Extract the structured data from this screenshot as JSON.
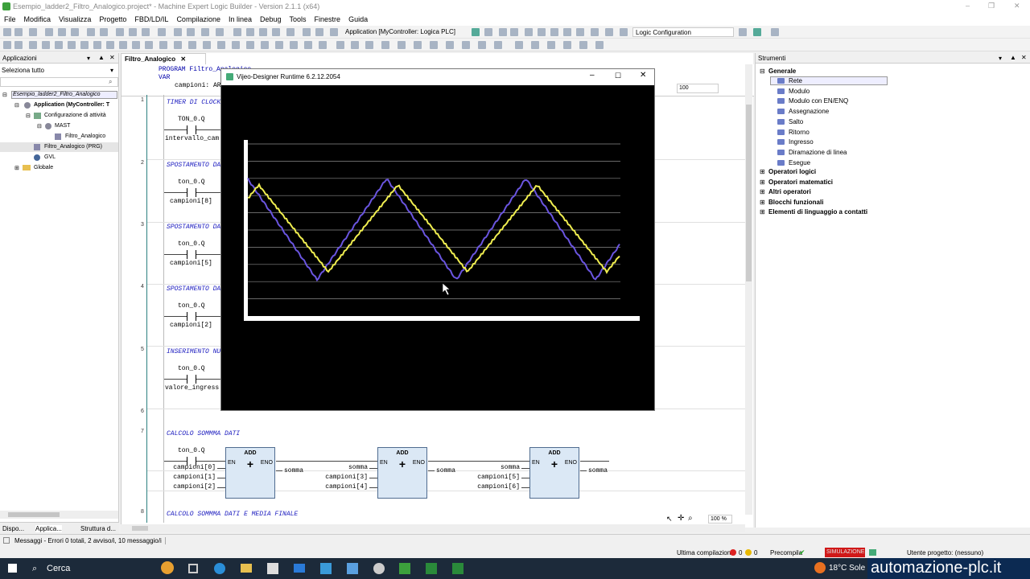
{
  "window": {
    "title": "Esempio_ladder2_Filtro_Analogico.project* - Machine Expert Logic Builder - Version 2.1.1 (x64)"
  },
  "menu": [
    "File",
    "Modifica",
    "Visualizza",
    "Progetto",
    "FBD/LD/IL",
    "Compilazione",
    "In linea",
    "Debug",
    "Tools",
    "Finestre",
    "Guida"
  ],
  "toolbar": {
    "application": "Application [MyController: Logica PLC]",
    "logic": "Logic Configuration"
  },
  "left": {
    "title": "Applicazioni",
    "select": "Seleziona tutto",
    "tree": [
      "Esempio_ladder2_Filtro_Analogico",
      "Application (MyController: T",
      "Configurazione di attività",
      "MAST",
      "Filtro_Analogico",
      "Filtro_Analogico (PRG)",
      "GVL",
      "Globale"
    ],
    "tabs": [
      "Dispo...",
      "Applica...",
      "Struttura d..."
    ]
  },
  "editor": {
    "tab": "Filtro_Analogico",
    "decl": [
      "PROGRAM Filtro_Analogico",
      "VAR",
      "campioni: ARRAY"
    ],
    "zoom_top": "100",
    "rungs": [
      {
        "num": "1",
        "title": "TIMER DI CLOCK",
        "contact": "TON_0.Q",
        "var": "intervallo_cam"
      },
      {
        "num": "2",
        "title": "SPOSTAMENTO DA",
        "contact": "ton_0.Q",
        "var": "campioni[8]"
      },
      {
        "num": "3",
        "title": "SPOSTAMENTO DA",
        "contact": "ton_0.Q",
        "var": "campioni[5]"
      },
      {
        "num": "4",
        "title": "SPOSTAMENTO DA",
        "contact": "ton_0.Q",
        "var": "campioni[2]"
      },
      {
        "num": "5",
        "title": "INSERIMENTO NU",
        "contact": "ton_0.Q",
        "var": "valore_ingress"
      },
      {
        "num": "6",
        "title": "",
        "contact": "",
        "var": ""
      },
      {
        "num": "7",
        "title": "CALCOLO SOMMMA DATI",
        "contact": "ton_0.Q",
        "var": ""
      },
      {
        "num": "8",
        "title": "CALCOLO SOMMMA DATI E MEDIA FINALE",
        "contact": "",
        "var": ""
      }
    ],
    "blocks": [
      {
        "name": "ADD",
        "en": "EN",
        "eno": "ENO",
        "inputs": [
          "campioni[0]",
          "campioni[1]",
          "campioni[2]"
        ],
        "output": "somma"
      },
      {
        "name": "ADD",
        "en": "EN",
        "eno": "ENO",
        "inputs": [
          "somma",
          "campioni[3]",
          "campioni[4]"
        ],
        "output": "somma"
      },
      {
        "name": "ADD",
        "en": "EN",
        "eno": "ENO",
        "inputs": [
          "somma",
          "campioni[5]",
          "campioni[6]"
        ],
        "output": "somma"
      }
    ],
    "zoom_bottom": "100 %"
  },
  "right": {
    "title": "Strumenti",
    "general": "Generale",
    "items": [
      "Rete",
      "Modulo",
      "Modulo con EN/ENQ",
      "Assegnazione",
      "Salto",
      "Ritorno",
      "Ingresso",
      "Diramazione di linea",
      "Esegue"
    ],
    "groups": [
      "Operatori logici",
      "Operatori matematici",
      "Altri operatori",
      "Blocchi funzionali",
      "Elementi di linguaggio a contatti"
    ]
  },
  "popup": {
    "title": "Vijeo-Designer Runtime 6.2.12.2054"
  },
  "status": {
    "messages": "Messaggi - Errori 0 totali, 2 avviso/i, 10 messaggio/i",
    "compile": "Ultima compilazione",
    "err": "0",
    "warn": "0",
    "precompile": "Precompila",
    "sim": "SIMULAZIONE",
    "user": "Utente progetto: (nessuno)"
  },
  "taskbar": {
    "search": "Cerca",
    "weather": "18°C  Sole",
    "brand": "automazione-plc.it"
  }
}
